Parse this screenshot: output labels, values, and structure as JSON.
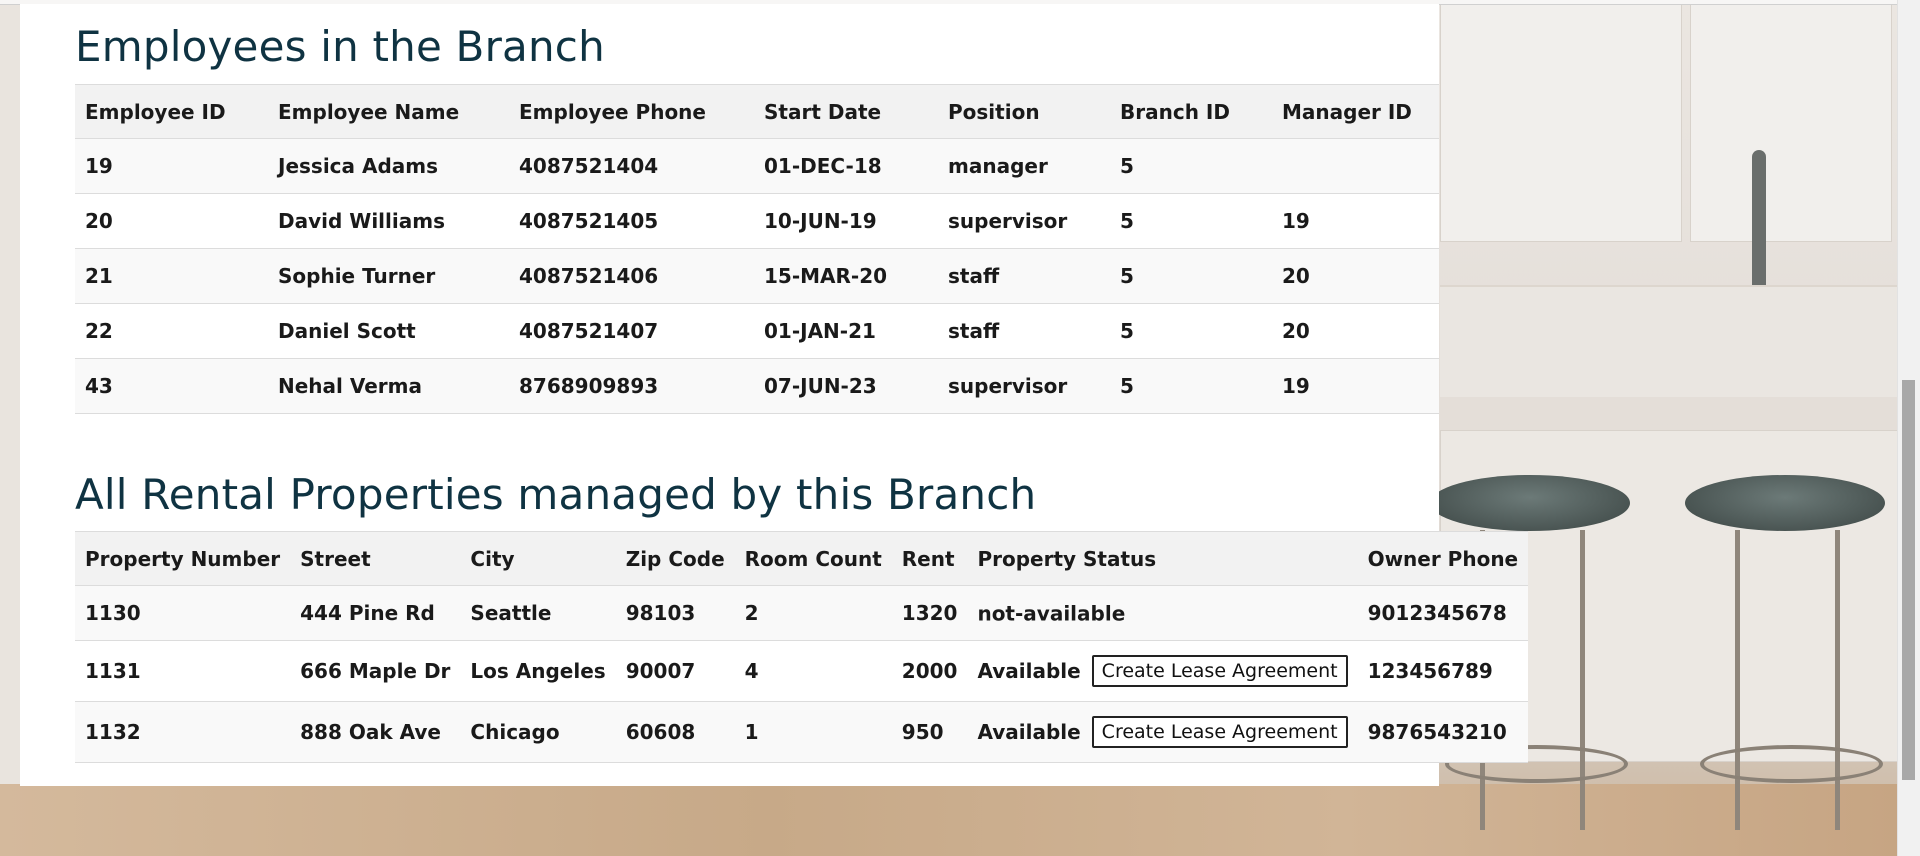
{
  "employees_section": {
    "title": "Employees in the Branch",
    "columns": [
      "Employee ID",
      "Employee Name",
      "Employee Phone",
      "Start Date",
      "Position",
      "Branch ID",
      "Manager ID"
    ],
    "rows": [
      [
        "19",
        "Jessica Adams",
        "4087521404",
        "01-DEC-18",
        "manager",
        "5",
        ""
      ],
      [
        "20",
        "David Williams",
        "4087521405",
        "10-JUN-19",
        "supervisor",
        "5",
        "19"
      ],
      [
        "21",
        "Sophie Turner",
        "4087521406",
        "15-MAR-20",
        "staff",
        "5",
        "20"
      ],
      [
        "22",
        "Daniel Scott",
        "4087521407",
        "01-JAN-21",
        "staff",
        "5",
        "20"
      ],
      [
        "43",
        "Nehal Verma",
        "8768909893",
        "07-JUN-23",
        "supervisor",
        "5",
        "19"
      ]
    ]
  },
  "properties_section": {
    "title": "All Rental Properties managed by this Branch",
    "columns": [
      "Property Number",
      "Street",
      "City",
      "Zip Code",
      "Room Count",
      "Rent",
      "Property Status",
      "Owner Phone"
    ],
    "rows": [
      {
        "number": "1130",
        "street": "444 Pine Rd",
        "city": "Seattle",
        "zip": "98103",
        "rooms": "2",
        "rent": "1320",
        "status": "not-available",
        "action": "",
        "owner_phone": "9012345678"
      },
      {
        "number": "1131",
        "street": "666 Maple Dr",
        "city": "Los Angeles",
        "zip": "90007",
        "rooms": "4",
        "rent": "2000",
        "status": "Available",
        "action": "Create Lease Agreement",
        "owner_phone": "123456789"
      },
      {
        "number": "1132",
        "street": "888 Oak Ave",
        "city": "Chicago",
        "zip": "60608",
        "rooms": "1",
        "rent": "950",
        "status": "Available",
        "action": "Create Lease Agreement",
        "owner_phone": "9876543210"
      }
    ]
  },
  "colors": {
    "heading": "#0f3342",
    "panel_background": "#ffffff",
    "header_row": "#f2f2f2"
  }
}
